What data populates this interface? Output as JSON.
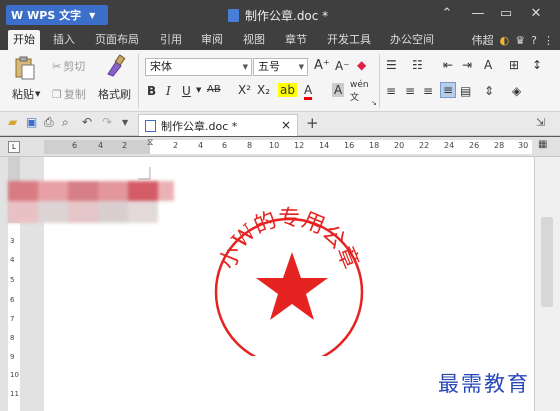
{
  "titlebar": {
    "app_name": "WPS 文字",
    "document_title": "制作公章.doc *"
  },
  "menu_tabs": [
    "开始",
    "插入",
    "页面布局",
    "引用",
    "审阅",
    "视图",
    "章节",
    "开发工具",
    "办公空间"
  ],
  "menu_right": {
    "user": "伟超",
    "help": "?"
  },
  "ribbon": {
    "paste_label": "粘贴",
    "cut_label": "剪切",
    "copy_label": "复制",
    "format_painter_label": "格式刷",
    "font_name": "宋体",
    "font_size": "五号"
  },
  "quickbar": {
    "document_tab": "制作公章.doc *",
    "close_glyph": "×",
    "new_tab_glyph": "+"
  },
  "ruler": {
    "horizontal_ticks": [
      "6",
      "4",
      "2",
      "2",
      "4",
      "6",
      "8",
      "10",
      "12",
      "14",
      "16",
      "18",
      "20",
      "22",
      "24",
      "26",
      "28",
      "30"
    ],
    "vertical_ticks": [
      "3",
      "4",
      "5",
      "6",
      "7",
      "8",
      "9",
      "10",
      "11"
    ]
  },
  "seal": {
    "text": "小W的专用公章",
    "color": "#e52421"
  },
  "watermark": "最需教育",
  "colors": {
    "accent": "#3c6fc9",
    "titlebar": "#3f3f3f",
    "seal_red": "#e52421"
  }
}
